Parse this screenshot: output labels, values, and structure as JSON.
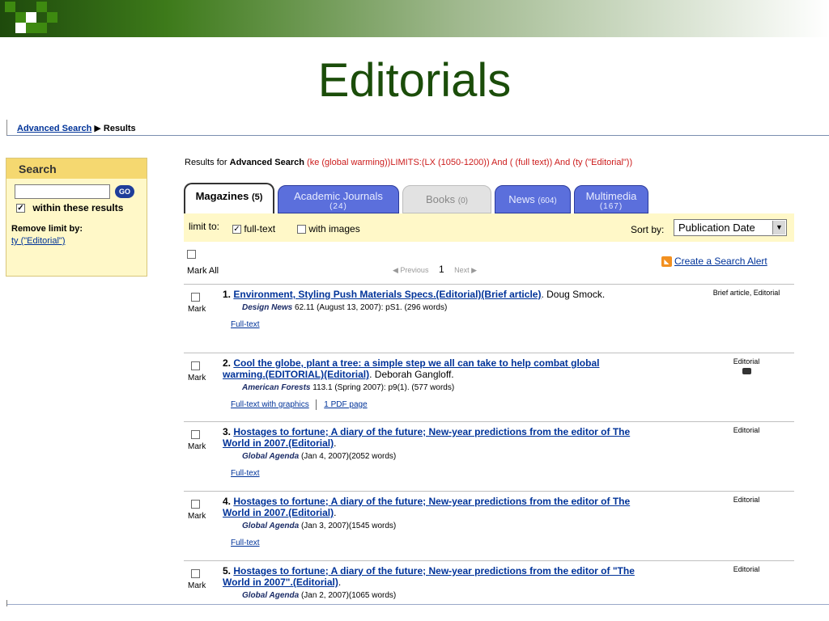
{
  "slide": {
    "title": "Editorials"
  },
  "breadcrumb": {
    "link": "Advanced Search",
    "separator": "▶",
    "current": "Results"
  },
  "search_panel": {
    "title": "Search",
    "input_value": "",
    "go_label": "GO",
    "within_checked": true,
    "within_label": "within these results",
    "remove_label": "Remove limit by:",
    "limit_link": "ty (\"Editorial\")"
  },
  "results_header": {
    "prefix": "Results for ",
    "search_type": "Advanced Search",
    "query": "(ke (global warming))LIMITS:(LX (1050-1200)) And ( (full text)) And (ty (\"Editorial\"))"
  },
  "tabs": [
    {
      "label": "Magazines",
      "count": "(5)",
      "state": "active"
    },
    {
      "label": "Academic Journals",
      "count": "(24)",
      "state": "blue"
    },
    {
      "label": "Books",
      "count": "(0)",
      "state": "grey"
    },
    {
      "label": "News",
      "count": "(604)",
      "state": "blue"
    },
    {
      "label": "Multimedia",
      "count": "(167)",
      "state": "blue"
    }
  ],
  "limit_bar": {
    "label": "limit to:",
    "fulltext_label": "full-text",
    "fulltext_checked": true,
    "images_label": "with images",
    "images_checked": false,
    "sort_label": "Sort by:",
    "sort_value": "Publication Date"
  },
  "mark_all": {
    "label": "Mark All",
    "prev": "◀ Previous",
    "page": "1",
    "next": "Next ▶",
    "alert_link": "Create a Search Alert"
  },
  "results": [
    {
      "num": "1.",
      "title": "Environment, Styling Push Materials Specs.(Editorial)(Brief article)",
      "author": ". Doug Smock.",
      "publication": "Design News",
      "details": " 62.11 (August 13, 2007): pS1. (296 words)",
      "links": [
        "Full-text"
      ],
      "doctype": "Brief article, Editorial",
      "has_camera": false,
      "mark": "Mark"
    },
    {
      "num": "2.",
      "title": "Cool the globe, plant a tree: a simple step we all can take to help combat global warming.(EDITORIAL)(Editorial)",
      "author": ". Deborah Gangloff.",
      "publication": "American Forests",
      "details": " 113.1 (Spring 2007): p9(1). (577 words)",
      "links": [
        "Full-text with graphics",
        "1 PDF page"
      ],
      "doctype": "Editorial",
      "has_camera": true,
      "mark": "Mark"
    },
    {
      "num": "3.",
      "title": "Hostages to fortune; A diary of the future; New-year predictions from the editor of The World in 2007.(Editorial)",
      "author": ".",
      "publication": "Global Agenda",
      "details": " (Jan 4, 2007)(2052 words)",
      "links": [
        "Full-text"
      ],
      "doctype": "Editorial",
      "has_camera": false,
      "mark": "Mark"
    },
    {
      "num": "4.",
      "title": "Hostages to fortune; A diary of the future; New-year predictions from the editor of The World in 2007.(Editorial)",
      "author": ".",
      "publication": "Global Agenda",
      "details": " (Jan 3, 2007)(1545 words)",
      "links": [
        "Full-text"
      ],
      "doctype": "Editorial",
      "has_camera": false,
      "mark": "Mark"
    },
    {
      "num": "5.",
      "title": "Hostages to fortune; A diary of the future; New-year predictions from the editor of \"The World in 2007\".(Editorial)",
      "author": ".",
      "publication": "Global Agenda",
      "details": " (Jan 2, 2007)(1065 words)",
      "links": [],
      "doctype": "Editorial",
      "has_camera": false,
      "mark": "Mark"
    }
  ],
  "colors": {
    "slide_title": "#1b4d0a",
    "link": "#003399",
    "query": "#cc1b1b",
    "panel_bg": "#fff8c8",
    "panel_title_bg": "#f5d870",
    "tab_blue": "#5b6fdc"
  }
}
